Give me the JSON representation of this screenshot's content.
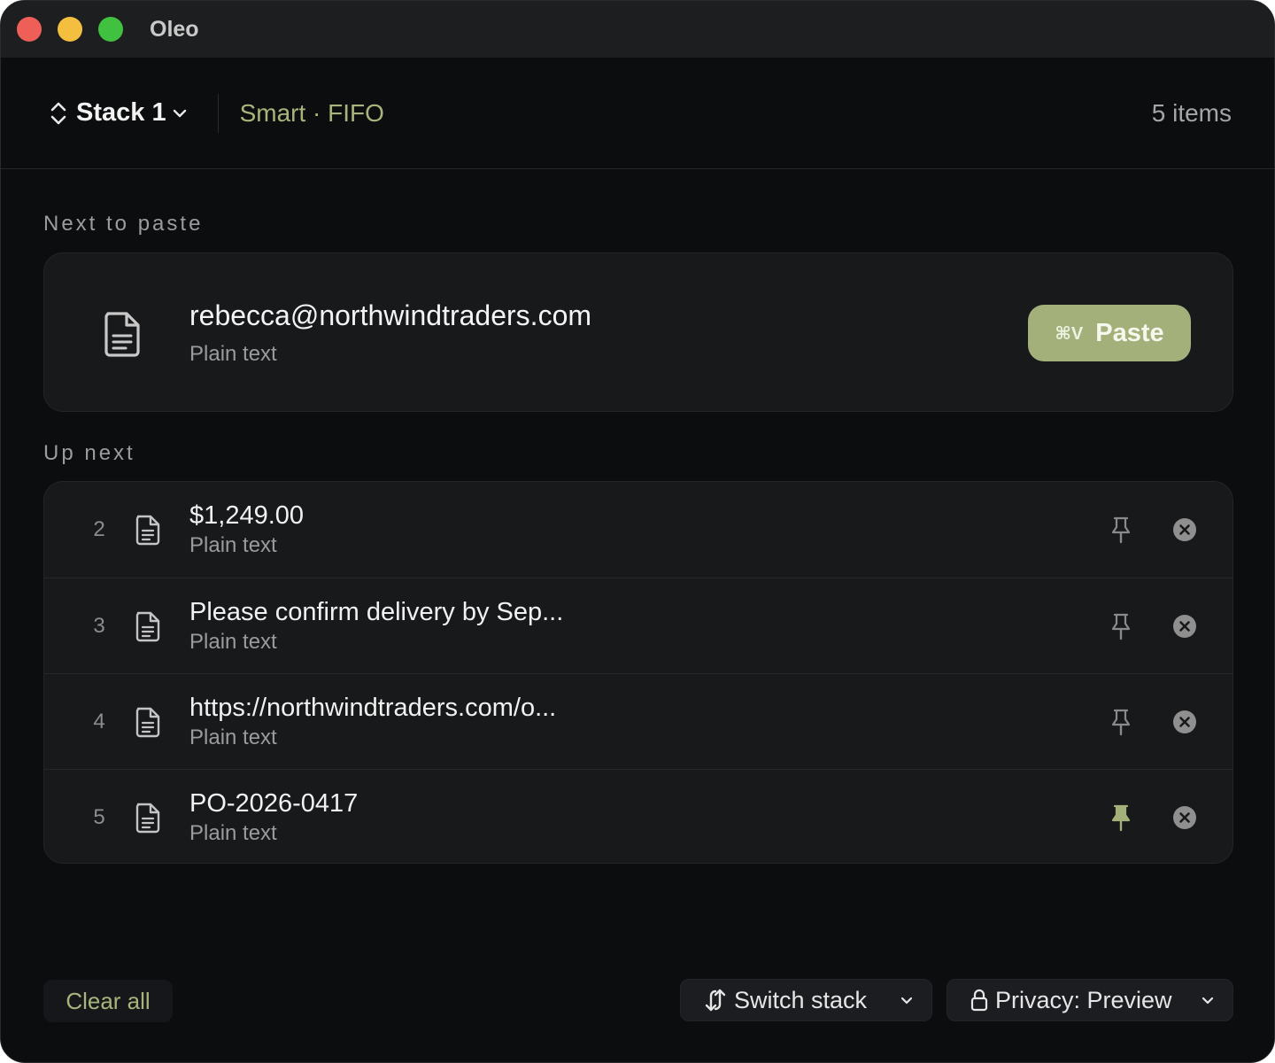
{
  "window": {
    "title": "Oleo"
  },
  "header": {
    "stack_name": "Stack 1",
    "mode": "Smart · FIFO",
    "item_count": "5 items"
  },
  "next": {
    "section_label": "Next to paste",
    "title": "rebecca@northwindtraders.com",
    "type": "Plain text",
    "paste_shortcut": "⌘V",
    "paste_label": "Paste"
  },
  "up_next": {
    "section_label": "Up next",
    "items": [
      {
        "index": "2",
        "title": "$1,249.00",
        "type": "Plain text",
        "pinned": false
      },
      {
        "index": "3",
        "title": "Please confirm delivery by Sep...",
        "type": "Plain text",
        "pinned": false
      },
      {
        "index": "4",
        "title": "https://northwindtraders.com/o...",
        "type": "Plain text",
        "pinned": false
      },
      {
        "index": "5",
        "title": "PO-2026-0417",
        "type": "Plain text",
        "pinned": true
      }
    ]
  },
  "footer": {
    "clear_label": "Clear all",
    "switch_label": "Switch stack",
    "privacy_label": "Privacy: Preview"
  },
  "colors": {
    "accent": "#a3b07a",
    "accent_text": "#a7b57c",
    "background": "#0c0d0e",
    "card": "#18191b"
  },
  "icons": {
    "stack_picker": "up-down-chevrons-icon",
    "document": "document-icon",
    "pin": "pin-icon",
    "remove": "close-circle-icon",
    "switch": "swap-arrows-icon",
    "privacy": "lock-icon",
    "dropdown": "chevron-down-icon"
  }
}
